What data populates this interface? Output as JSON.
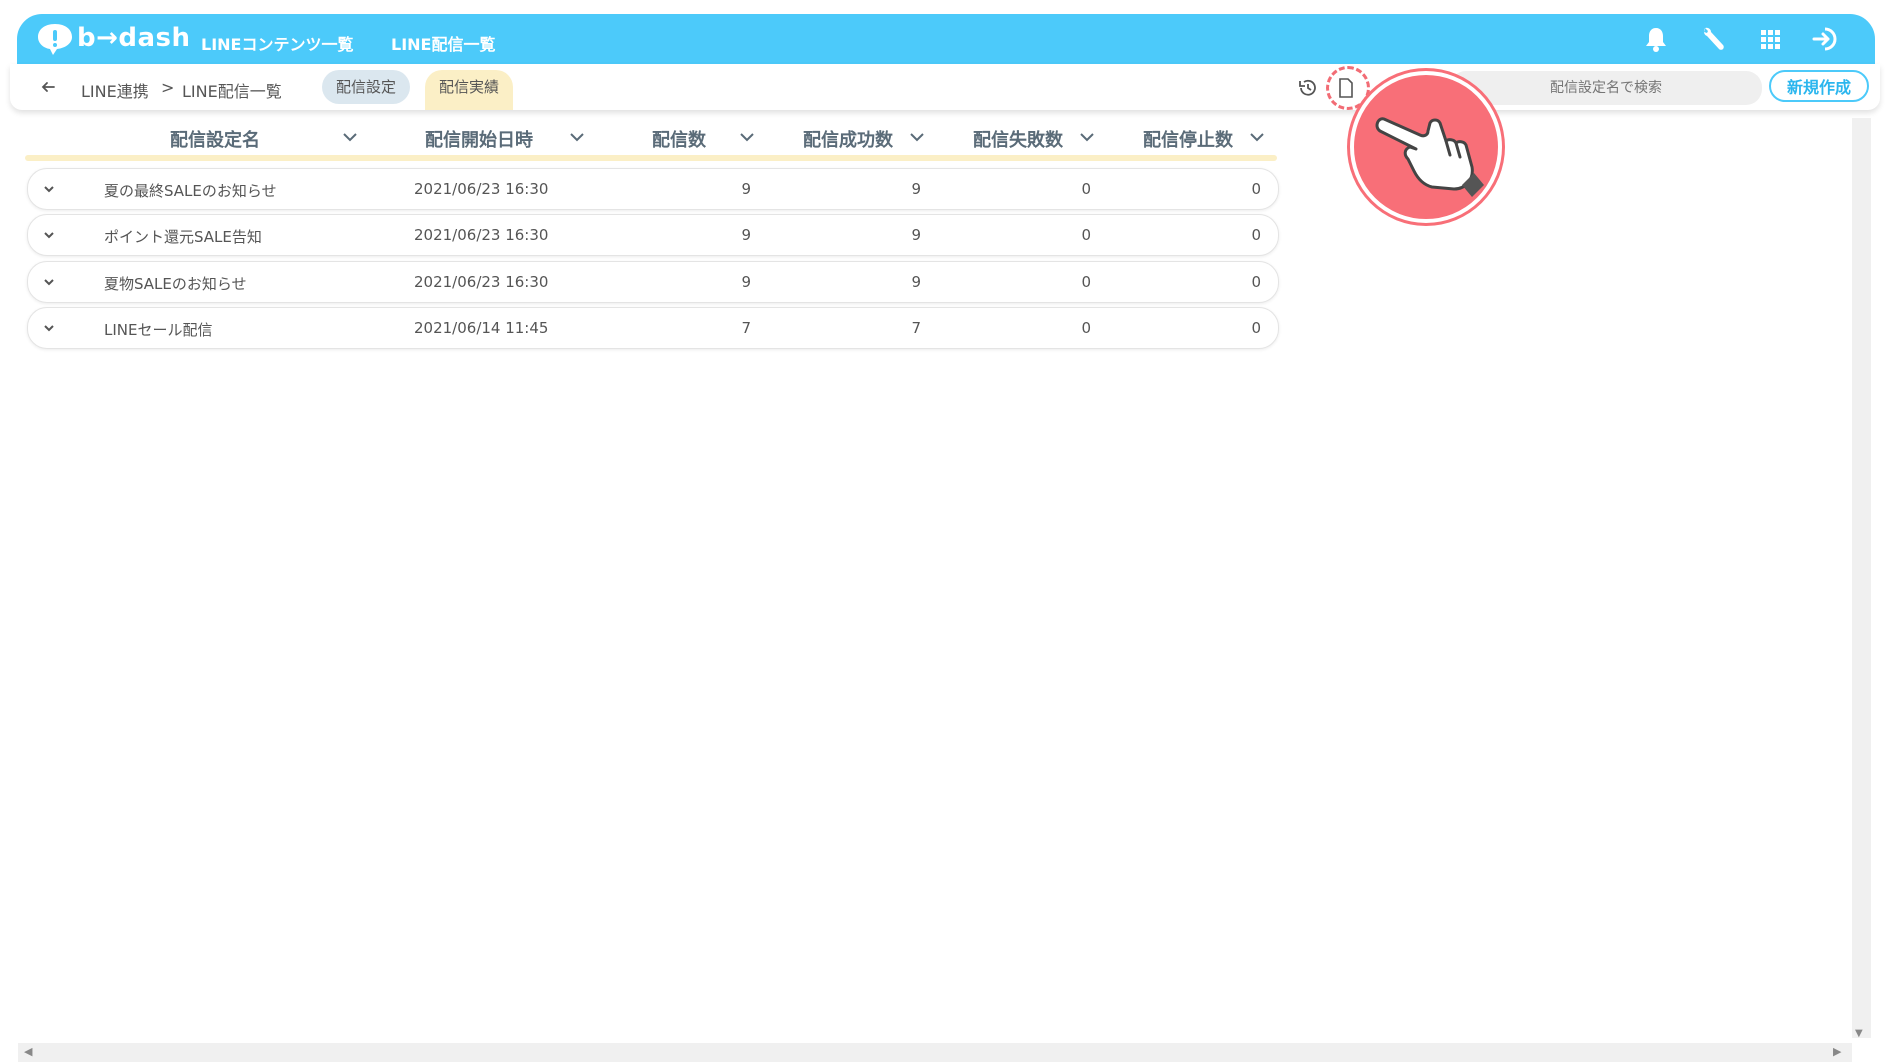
{
  "app": {
    "logo_text": "b→dash",
    "brand_color": "#4ccafa",
    "accent_color": "#2bb6ee",
    "tab_active_color": "#fbefc6",
    "pointer_color": "#f86f78"
  },
  "topnav": {
    "links": [
      {
        "label": "LINEコンテンツ一覧"
      },
      {
        "label": "LINE配信一覧"
      }
    ],
    "icons": [
      "bell-icon",
      "wrench-icon",
      "apps-grid-icon",
      "logout-icon"
    ]
  },
  "subheader": {
    "breadcrumb": {
      "parent": "LINE連携",
      "separator": ">",
      "current": "LINE配信一覧"
    },
    "tabs": [
      {
        "label": "配信設定",
        "active": false
      },
      {
        "label": "配信実績",
        "active": true
      }
    ],
    "icons": [
      "history-icon",
      "copy-icon"
    ],
    "search_placeholder": "配信設定名で検索",
    "new_button_label": "新規作成"
  },
  "table": {
    "columns": [
      {
        "label": "配信設定名"
      },
      {
        "label": "配信開始日時"
      },
      {
        "label": "配信数"
      },
      {
        "label": "配信成功数"
      },
      {
        "label": "配信失敗数"
      },
      {
        "label": "配信停止数"
      }
    ],
    "rows": [
      {
        "name": "夏の最終SALEのお知らせ",
        "start": "2021/06/23 16:30",
        "sent": "9",
        "success": "9",
        "failed": "0",
        "stopped": "0"
      },
      {
        "name": "ポイント還元SALE告知",
        "start": "2021/06/23 16:30",
        "sent": "9",
        "success": "9",
        "failed": "0",
        "stopped": "0"
      },
      {
        "name": "夏物SALEのお知らせ",
        "start": "2021/06/23 16:30",
        "sent": "9",
        "success": "9",
        "failed": "0",
        "stopped": "0"
      },
      {
        "name": "LINEセール配信",
        "start": "2021/06/14 11:45",
        "sent": "7",
        "success": "7",
        "failed": "0",
        "stopped": "0"
      }
    ]
  }
}
